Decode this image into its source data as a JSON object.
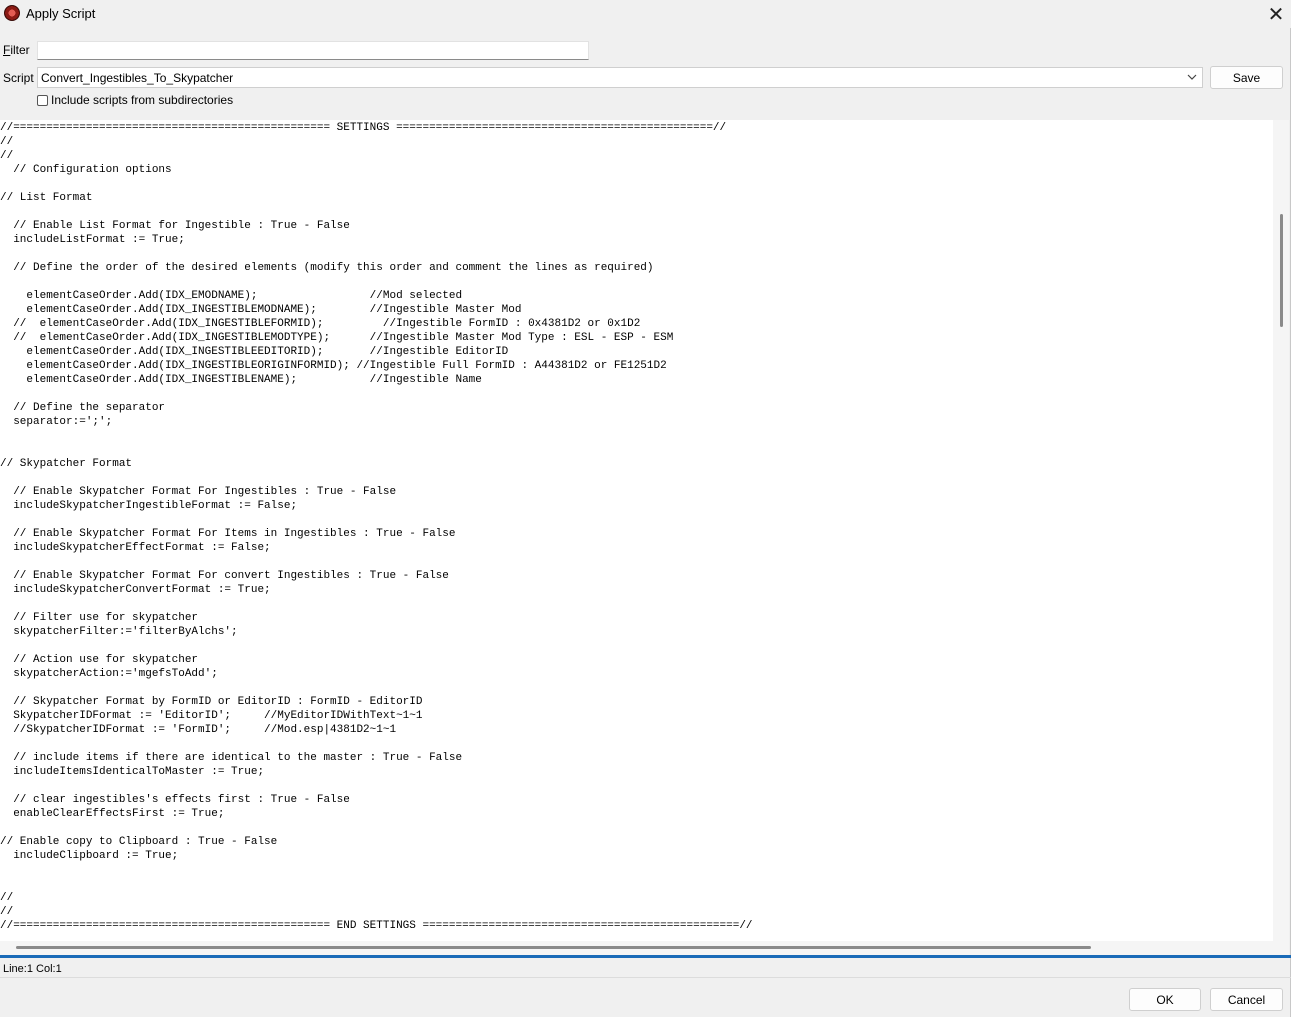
{
  "window": {
    "title": "Apply Script",
    "close_glyph": "✕"
  },
  "filter": {
    "label_prefix": "",
    "label_accel": "F",
    "label_rest": "ilter",
    "value": ""
  },
  "script": {
    "label": "Script",
    "selected": "Convert_Ingestibles_To_Skypatcher",
    "save_label": "Save"
  },
  "include_subdirs": {
    "label": "Include scripts from subdirectories",
    "checked": false
  },
  "editor": {
    "code": "//================================================ SETTINGS ================================================//\n//\n//\n  // Configuration options\n\n// List Format\n\n  // Enable List Format for Ingestible : True - False\n  includeListFormat := True;\n\n  // Define the order of the desired elements (modify this order and comment the lines as required)\n\n    elementCaseOrder.Add(IDX_EMODNAME);                 //Mod selected\n    elementCaseOrder.Add(IDX_INGESTIBLEMODNAME);        //Ingestible Master Mod\n  //  elementCaseOrder.Add(IDX_INGESTIBLEFORMID);         //Ingestible FormID : 0x4381D2 or 0x1D2\n  //  elementCaseOrder.Add(IDX_INGESTIBLEMODTYPE);      //Ingestible Master Mod Type : ESL - ESP - ESM\n    elementCaseOrder.Add(IDX_INGESTIBLEEDITORID);       //Ingestible EditorID\n    elementCaseOrder.Add(IDX_INGESTIBLEORIGINFORMID); //Ingestible Full FormID : A44381D2 or FE1251D2\n    elementCaseOrder.Add(IDX_INGESTIBLENAME);           //Ingestible Name\n\n  // Define the separator\n  separator:=';';\n\n\n// Skypatcher Format\n\n  // Enable Skypatcher Format For Ingestibles : True - False\n  includeSkypatcherIngestibleFormat := False;\n\n  // Enable Skypatcher Format For Items in Ingestibles : True - False\n  includeSkypatcherEffectFormat := False;\n\n  // Enable Skypatcher Format For convert Ingestibles : True - False\n  includeSkypatcherConvertFormat := True;\n\n  // Filter use for skypatcher\n  skypatcherFilter:='filterByAlchs';\n\n  // Action use for skypatcher\n  skypatcherAction:='mgefsToAdd';\n\n  // Skypatcher Format by FormID or EditorID : FormID - EditorID\n  SkypatcherIDFormat := 'EditorID';     //MyEditorIDWithText~1~1\n  //SkypatcherIDFormat := 'FormID';     //Mod.esp|4381D2~1~1\n\n  // include items if there are identical to the master : True - False\n  includeItemsIdenticalToMaster := True;\n\n  // clear ingestibles's effects first : True - False\n  enableClearEffectsFirst := True;\n\n// Enable copy to Clipboard : True - False\n  includeClipboard := True;\n\n\n//\n//\n//================================================ END SETTINGS ================================================//"
  },
  "status": {
    "text": "Line:1 Col:1"
  },
  "buttons": {
    "ok": "OK",
    "cancel": "Cancel"
  },
  "icons": {
    "app": "app-icon",
    "close": "close-icon",
    "dropdown": "chevron-down-icon"
  }
}
